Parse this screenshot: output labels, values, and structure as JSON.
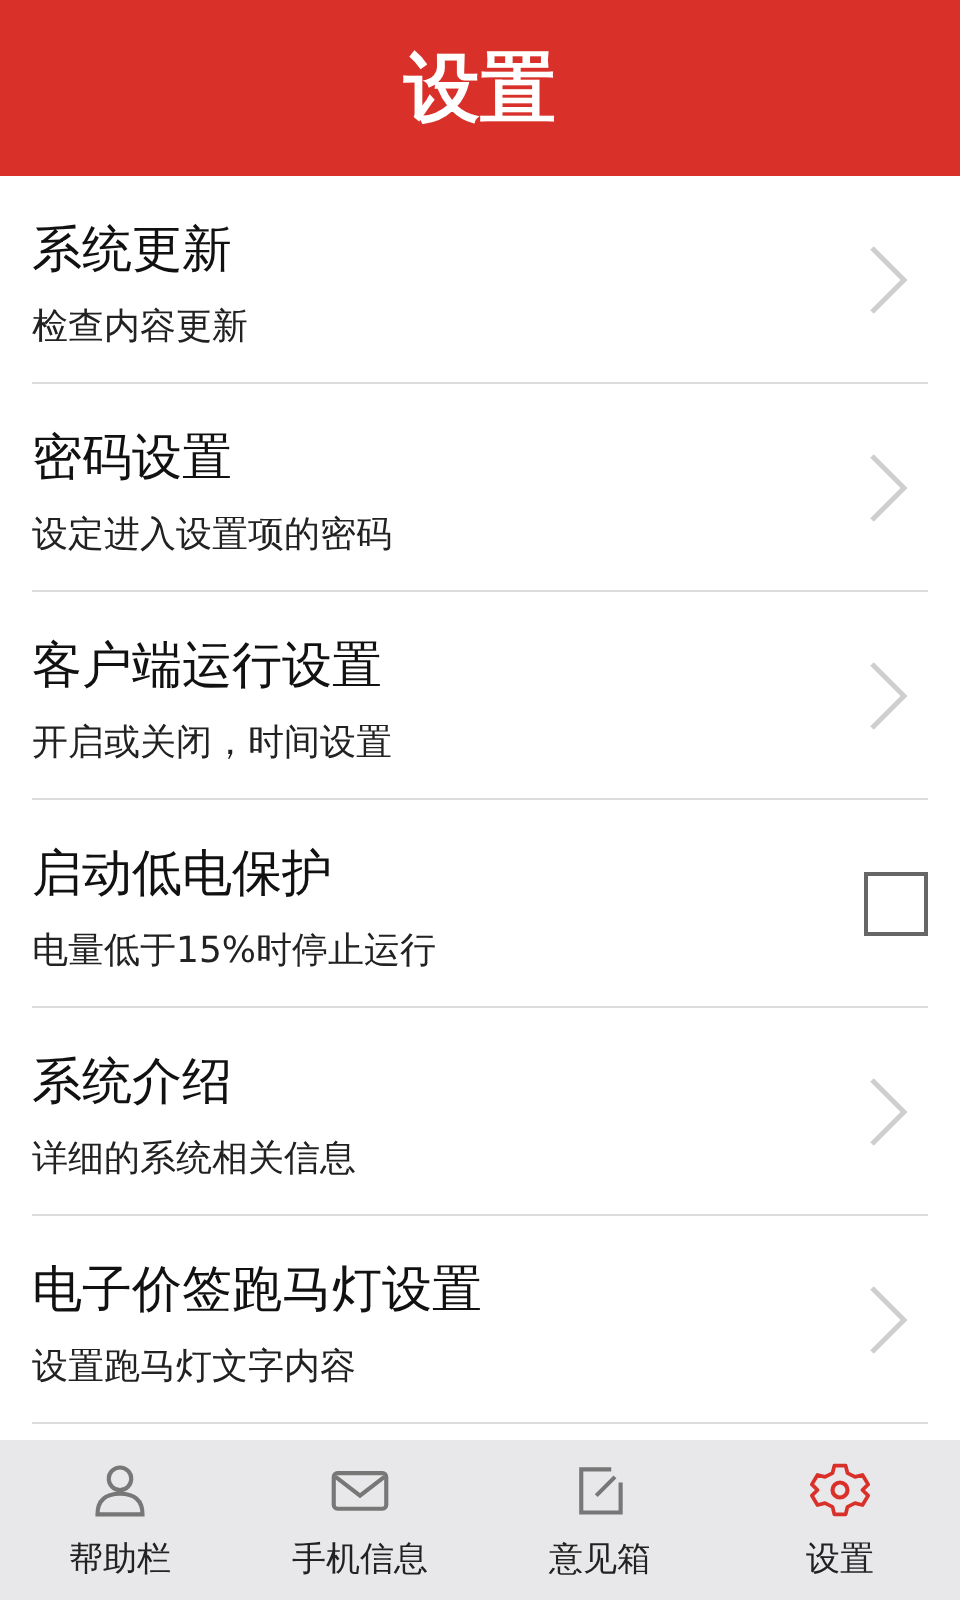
{
  "header": {
    "title": "设置"
  },
  "items": [
    {
      "kind": "link",
      "title": "系统更新",
      "subtitle": "检查内容更新"
    },
    {
      "kind": "link",
      "title": "密码设置",
      "subtitle": "设定进入设置项的密码"
    },
    {
      "kind": "link",
      "title": "客户端运行设置",
      "subtitle": "开启或关闭，时间设置"
    },
    {
      "kind": "checkbox",
      "title": "启动低电保护",
      "subtitle": "电量低于15%时停止运行",
      "checked": false
    },
    {
      "kind": "link",
      "title": "系统介绍",
      "subtitle": "详细的系统相关信息"
    },
    {
      "kind": "link",
      "title": "电子价签跑马灯设置",
      "subtitle": "设置跑马灯文字内容"
    }
  ],
  "tabs": [
    {
      "kind": "person",
      "label": "帮助栏",
      "selected": false
    },
    {
      "kind": "mail",
      "label": "手机信息",
      "selected": false
    },
    {
      "kind": "edit",
      "label": "意见箱",
      "selected": false
    },
    {
      "kind": "gear",
      "label": "设置",
      "selected": true
    }
  ]
}
